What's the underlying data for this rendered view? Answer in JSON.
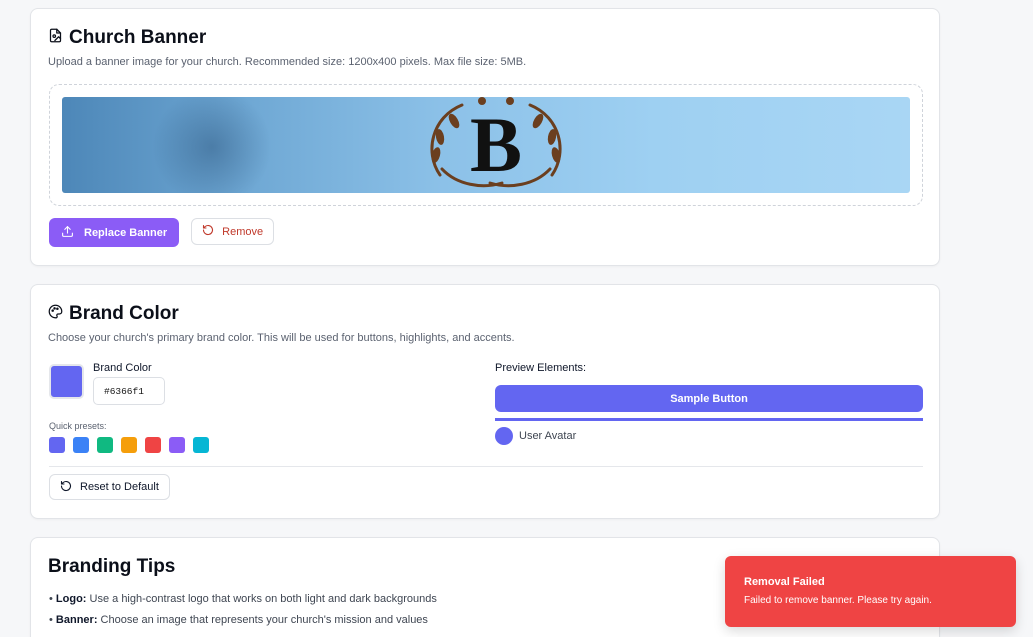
{
  "banner": {
    "title": "Church Banner",
    "description": "Upload a banner image for your church. Recommended size: 1200x400 pixels. Max file size: 5MB.",
    "logo_letter": "B",
    "replace_label": "Replace Banner",
    "remove_label": "Remove"
  },
  "brand": {
    "title": "Brand Color",
    "description": "Choose your church's primary brand color. This will be used for buttons, highlights, and accents.",
    "field_label": "Brand Color",
    "hex_value": "#6366f1",
    "presets_label": "Quick presets:",
    "presets": [
      "#6366f1",
      "#3b82f6",
      "#10b981",
      "#f59e0b",
      "#ef4444",
      "#8b5cf6",
      "#06b6d4"
    ],
    "reset_label": "Reset to Default",
    "preview_label": "Preview Elements:",
    "sample_button": "Sample Button",
    "avatar_label": "User Avatar"
  },
  "tips": {
    "title": "Branding Tips",
    "items": [
      {
        "bold": "Logo:",
        "text": " Use a high-contrast logo that works on both light and dark backgrounds"
      },
      {
        "bold": "Banner:",
        "text": " Choose an image that represents your church's mission and values"
      }
    ]
  },
  "toast": {
    "title": "Removal Failed",
    "message": "Failed to remove banner. Please try again."
  },
  "colors": {
    "accent": "#8b5cf6",
    "brand": "#6366f1",
    "error": "#ef4444"
  }
}
